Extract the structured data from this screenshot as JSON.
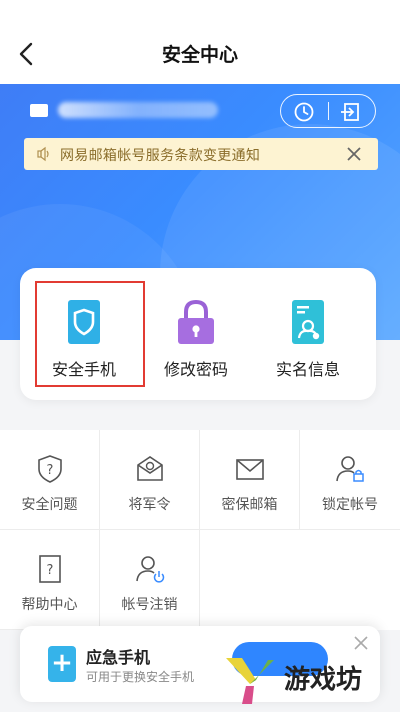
{
  "nav": {
    "title": "安全中心"
  },
  "notice": {
    "text": "网易邮箱帐号服务条款变更通知"
  },
  "primary_actions": [
    {
      "label": "安全手机",
      "icon": "shield-phone-icon"
    },
    {
      "label": "修改密码",
      "icon": "lock-icon"
    },
    {
      "label": "实名信息",
      "icon": "id-document-icon"
    }
  ],
  "grid_items": [
    {
      "label": "安全问题",
      "icon": "question-shield-icon"
    },
    {
      "label": "将军令",
      "icon": "token-envelope-icon"
    },
    {
      "label": "密保邮箱",
      "icon": "mail-icon"
    },
    {
      "label": "锁定帐号",
      "icon": "user-lock-icon"
    },
    {
      "label": "帮助中心",
      "icon": "help-doc-icon"
    },
    {
      "label": "帐号注销",
      "icon": "user-power-icon"
    }
  ],
  "promo": {
    "title": "应急手机",
    "subtitle": "可用于更换安全手机"
  },
  "watermark": {
    "text": "游戏坊"
  },
  "colors": {
    "accent": "#3a8cff",
    "highlight": "#e23b32",
    "notice_bg": "#fdf3d2"
  }
}
